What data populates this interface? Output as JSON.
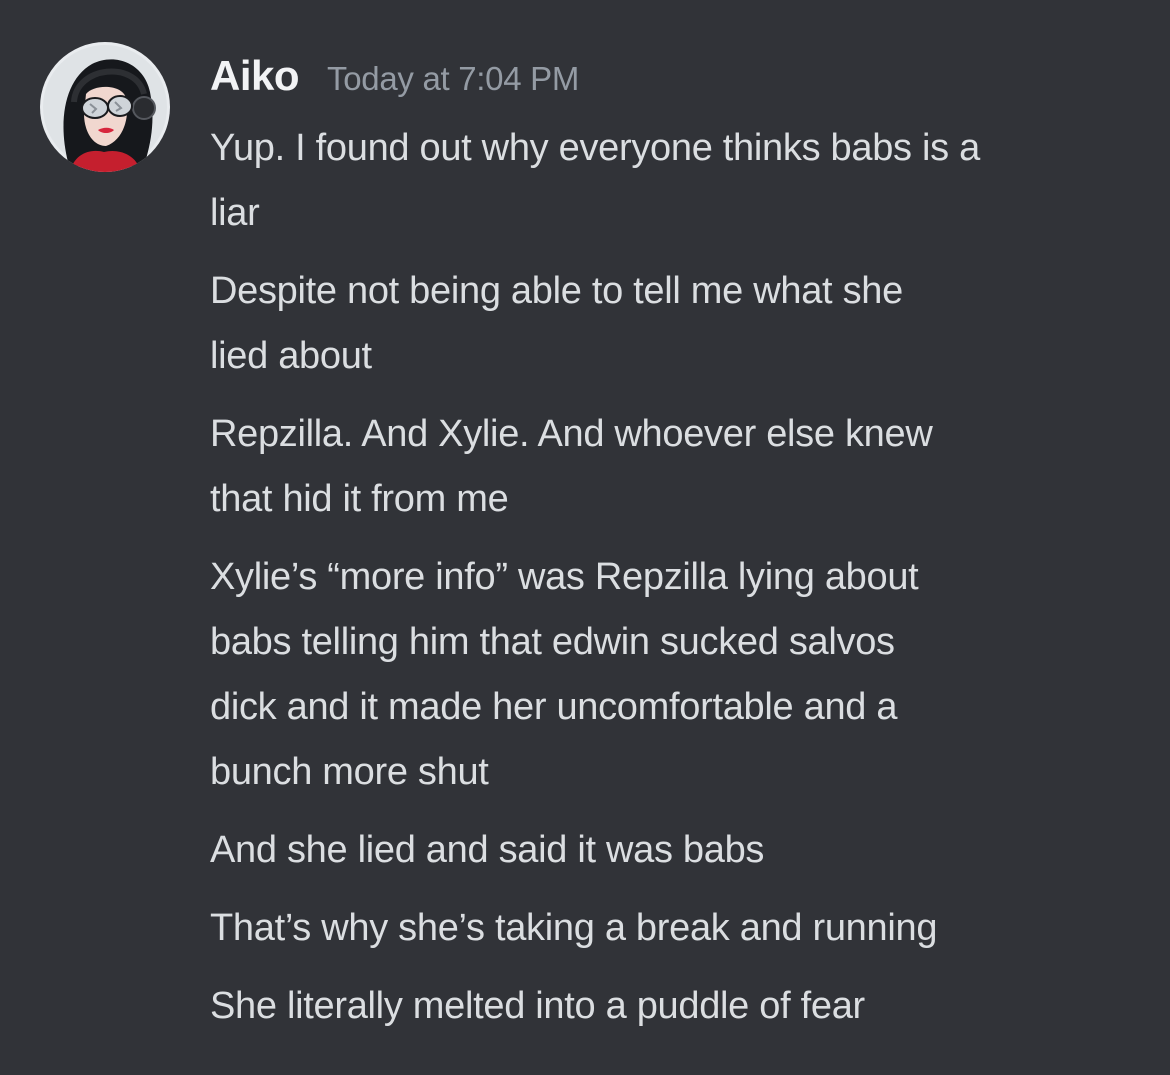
{
  "author": {
    "name": "Aiko",
    "timestamp": "Today at 7:04 PM",
    "avatar_icon": "user-avatar-icon"
  },
  "messages": [
    {
      "lines": [
        "Yup. I found out why everyone thinks babs is a",
        "liar"
      ]
    },
    {
      "lines": [
        "Despite not being able to tell me what she",
        "lied about"
      ]
    },
    {
      "lines": [
        "Repzilla. And Xylie. And whoever else knew",
        "that hid it from me"
      ]
    },
    {
      "lines": [
        "Xylie’s “more info” was Repzilla lying about",
        "babs telling him that edwin sucked salvos",
        "dick and it made her uncomfortable and a",
        "bunch more shut"
      ]
    },
    {
      "lines": [
        "And she lied and said it was babs"
      ]
    },
    {
      "lines": [
        "That’s why she’s taking a break and running"
      ]
    },
    {
      "lines": [
        "She literally melted into a puddle of fear"
      ]
    }
  ],
  "colors": {
    "background": "#313338",
    "username": "#f2f3f5",
    "timestamp": "#949ba4",
    "message_text": "#dbdee1"
  }
}
